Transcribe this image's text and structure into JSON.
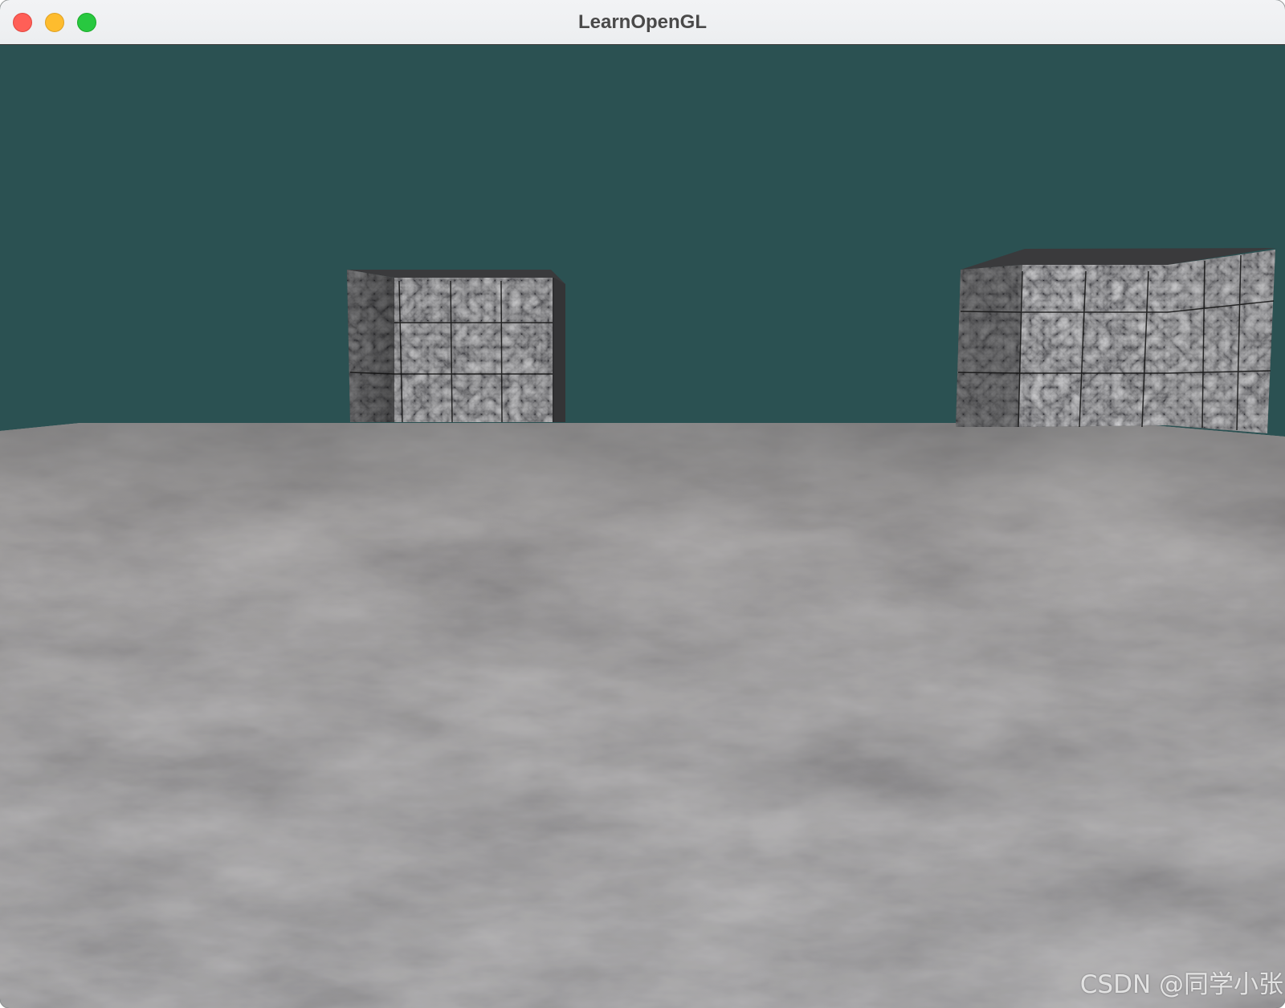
{
  "window": {
    "title": "LearnOpenGL",
    "controls": [
      "close",
      "minimize",
      "zoom"
    ]
  },
  "scene": {
    "clear_color": "#2b5152",
    "floor_texture": "gray-rock-texture",
    "cube_texture": "dark-marble-texture",
    "objects": [
      "floor",
      "cube-left",
      "cube-right"
    ]
  },
  "watermark": "CSDN @同学小张"
}
